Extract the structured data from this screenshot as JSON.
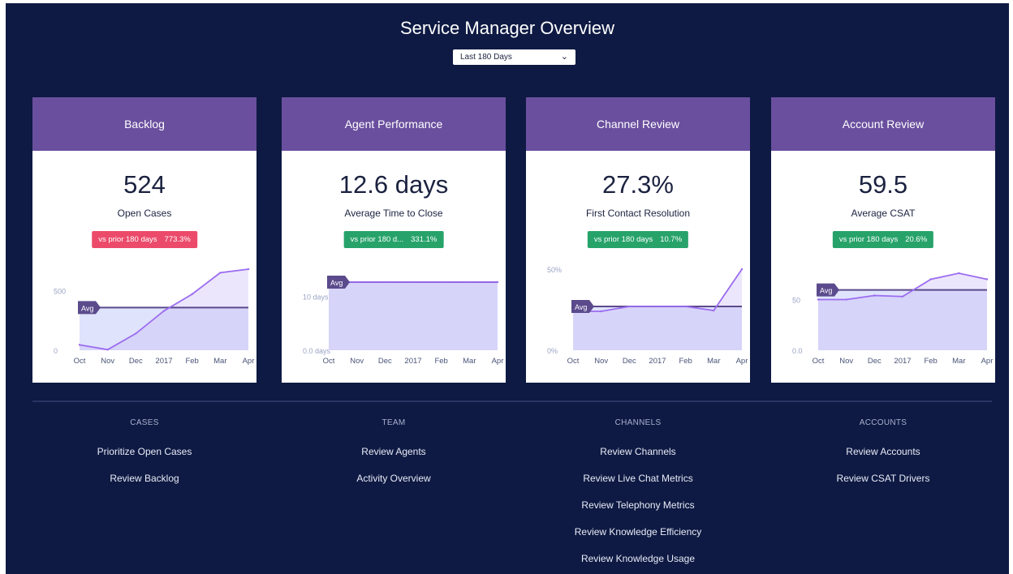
{
  "page": {
    "title": "Service Manager Overview",
    "range_select": "Last 180 Days",
    "chevron": "chevron-down-icon"
  },
  "colors": {
    "background": "#0e1a43",
    "card_header": "#6a4f9e",
    "line": "#9b6cf0",
    "avg_line": "#5b4a8c",
    "badge_red": "#ec4a6a",
    "badge_green": "#27a36a"
  },
  "cards": [
    {
      "header": "Backlog",
      "value": "524",
      "label": "Open Cases",
      "badge": {
        "text": "vs prior 180 days",
        "pct": "773.3%",
        "color": "red"
      },
      "chart_data": {
        "type": "area",
        "x": [
          "Oct",
          "Nov",
          "Dec",
          "2017",
          "Feb",
          "Mar",
          "Apr"
        ],
        "values": [
          45,
          5,
          140,
          330,
          470,
          650,
          680
        ],
        "avg": 358,
        "avg_label": "Avg",
        "ylim": [
          0,
          680
        ],
        "yticks": [
          {
            "v": 500,
            "label": "500"
          },
          {
            "v": 0,
            "label": "0"
          }
        ]
      }
    },
    {
      "header": "Agent Performance",
      "value": "12.6 days",
      "label": "Average Time to Close",
      "badge": {
        "text": "vs prior 180 d...",
        "pct": "331.1%",
        "color": "green"
      },
      "chart_data": {
        "type": "area",
        "x": [
          "Oct",
          "Nov",
          "Dec",
          "2017",
          "Feb",
          "Mar",
          "Apr"
        ],
        "values": [
          12.6,
          12.6,
          12.6,
          12.6,
          12.6,
          12.6,
          12.6
        ],
        "avg": 12.6,
        "avg_label": "Avg",
        "ylim": [
          0,
          15
        ],
        "yticks": [
          {
            "v": 10,
            "label": "10 days"
          },
          {
            "v": 0,
            "label": "0.0 days"
          }
        ]
      }
    },
    {
      "header": "Channel Review",
      "value": "27.3%",
      "label": "First Contact Resolution",
      "badge": {
        "text": "vs prior 180 days",
        "pct": "10.7%",
        "color": "green"
      },
      "chart_data": {
        "type": "area",
        "x": [
          "Oct",
          "Nov",
          "Dec",
          "2017",
          "Feb",
          "Mar",
          "Apr"
        ],
        "values": [
          24,
          24,
          27,
          27,
          27,
          24.5,
          50
        ],
        "avg": 27,
        "avg_label": "Avg",
        "ylim": [
          0,
          50
        ],
        "yticks": [
          {
            "v": 50,
            "label": "50%"
          },
          {
            "v": 0,
            "label": "0%"
          }
        ]
      }
    },
    {
      "header": "Account Review",
      "value": "59.5",
      "label": "Average CSAT",
      "badge": {
        "text": "vs prior 180 days",
        "pct": "20.6%",
        "color": "green"
      },
      "chart_data": {
        "type": "area",
        "x": [
          "Oct",
          "Nov",
          "Dec",
          "2017",
          "Feb",
          "Mar",
          "Apr"
        ],
        "values": [
          50,
          50,
          54,
          53,
          70,
          76,
          70
        ],
        "avg": 59.5,
        "avg_label": "Avg",
        "ylim": [
          0,
          80
        ],
        "yticks": [
          {
            "v": 50,
            "label": "50"
          },
          {
            "v": 0,
            "label": "0.0"
          }
        ]
      }
    }
  ],
  "sections": [
    {
      "heading": "CASES",
      "links": [
        "Prioritize Open Cases",
        "Review Backlog"
      ]
    },
    {
      "heading": "TEAM",
      "links": [
        "Review Agents",
        "Activity Overview"
      ]
    },
    {
      "heading": "CHANNELS",
      "links": [
        "Review Channels",
        "Review Live Chat Metrics",
        "Review Telephony Metrics",
        "Review Knowledge Efficiency",
        "Review Knowledge Usage"
      ]
    },
    {
      "heading": "ACCOUNTS",
      "links": [
        "Review Accounts",
        "Review CSAT Drivers"
      ]
    }
  ]
}
